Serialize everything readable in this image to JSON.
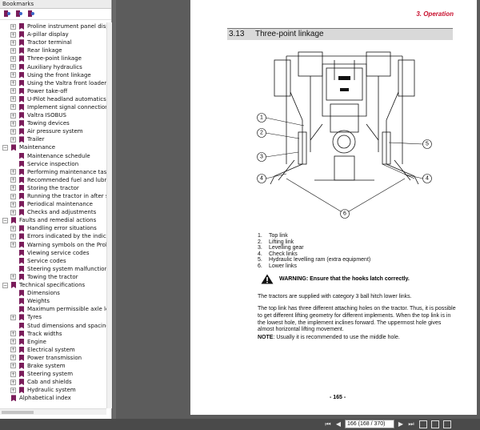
{
  "panel": {
    "title": "Bookmarks",
    "items": [
      {
        "label": "Proline instrument panel display",
        "level": 1,
        "expander": "+"
      },
      {
        "label": "A-pillar display",
        "level": 1,
        "expander": "+"
      },
      {
        "label": "Tractor terminal",
        "level": 1,
        "expander": "+"
      },
      {
        "label": "Rear linkage",
        "level": 1,
        "expander": "+"
      },
      {
        "label": "Three-point linkage",
        "level": 1,
        "expander": "+"
      },
      {
        "label": "Auxiliary hydraulics",
        "level": 1,
        "expander": "+"
      },
      {
        "label": "Using the front linkage",
        "level": 1,
        "expander": "+"
      },
      {
        "label": "Using the Valtra front loader",
        "level": 1,
        "expander": "+"
      },
      {
        "label": "Power take-off",
        "level": 1,
        "expander": "+"
      },
      {
        "label": "U-Pilot headland automatics",
        "level": 1,
        "expander": "+"
      },
      {
        "label": "Implement signal connection",
        "level": 1,
        "expander": "+"
      },
      {
        "label": "Valtra ISOBUS",
        "level": 1,
        "expander": "+"
      },
      {
        "label": "Towing devices",
        "level": 1,
        "expander": "+"
      },
      {
        "label": "Air pressure system",
        "level": 1,
        "expander": "+"
      },
      {
        "label": "Trailer",
        "level": 1,
        "expander": "+"
      },
      {
        "label": "Maintenance",
        "level": 0,
        "expander": "−"
      },
      {
        "label": "Maintenance schedule",
        "level": 1,
        "expander": ""
      },
      {
        "label": "Service inspection",
        "level": 1,
        "expander": ""
      },
      {
        "label": "Performing maintenance tasks",
        "level": 1,
        "expander": "+"
      },
      {
        "label": "Recommended fuel and lubricants",
        "level": 1,
        "expander": "+"
      },
      {
        "label": "Storing the tractor",
        "level": 1,
        "expander": "+"
      },
      {
        "label": "Running the tractor in after storage",
        "level": 1,
        "expander": "+"
      },
      {
        "label": "Periodical maintenance",
        "level": 1,
        "expander": "+"
      },
      {
        "label": "Checks and adjustments",
        "level": 1,
        "expander": "+"
      },
      {
        "label": "Faults and remedial actions",
        "level": 0,
        "expander": "−"
      },
      {
        "label": "Handling error situations",
        "level": 1,
        "expander": "+"
      },
      {
        "label": "Errors indicated by the indicator",
        "level": 1,
        "expander": "+"
      },
      {
        "label": "Warning symbols on the Proline",
        "level": 1,
        "expander": "+"
      },
      {
        "label": "Viewing service codes",
        "level": 1,
        "expander": ""
      },
      {
        "label": "Service codes",
        "level": 1,
        "expander": ""
      },
      {
        "label": "Steering system malfunctions",
        "level": 1,
        "expander": ""
      },
      {
        "label": "Towing the tractor",
        "level": 1,
        "expander": "+"
      },
      {
        "label": "Technical specifications",
        "level": 0,
        "expander": "−"
      },
      {
        "label": "Dimensions",
        "level": 1,
        "expander": ""
      },
      {
        "label": "Weights",
        "level": 1,
        "expander": ""
      },
      {
        "label": "Maximum permissible axle loadings",
        "level": 1,
        "expander": ""
      },
      {
        "label": "Tyres",
        "level": 1,
        "expander": "+"
      },
      {
        "label": "Stud dimensions and spacing for",
        "level": 1,
        "expander": ""
      },
      {
        "label": "Track widths",
        "level": 1,
        "expander": "+"
      },
      {
        "label": "Engine",
        "level": 1,
        "expander": "+"
      },
      {
        "label": "Electrical system",
        "level": 1,
        "expander": "+"
      },
      {
        "label": "Power transmission",
        "level": 1,
        "expander": "+"
      },
      {
        "label": "Brake system",
        "level": 1,
        "expander": "+"
      },
      {
        "label": "Steering system",
        "level": 1,
        "expander": "+"
      },
      {
        "label": "Cab and shields",
        "level": 1,
        "expander": "+"
      },
      {
        "label": "Hydraulic system",
        "level": 1,
        "expander": "+"
      },
      {
        "label": "Alphabetical index",
        "level": 0,
        "expander": ""
      }
    ]
  },
  "page": {
    "header": "3. Operation",
    "section_number": "3.13",
    "section_title": "Three-point linkage",
    "callouts": [
      "1",
      "2",
      "3",
      "4",
      "5",
      "4",
      "6"
    ],
    "legend": [
      {
        "n": "1.",
        "text": "Top link"
      },
      {
        "n": "2.",
        "text": "Lifting link"
      },
      {
        "n": "3.",
        "text": "Levelling gear"
      },
      {
        "n": "4.",
        "text": "Check links"
      },
      {
        "n": "5.",
        "text": "Hydraulic levelling ram (extra equipment)"
      },
      {
        "n": "6.",
        "text": "Lower links"
      }
    ],
    "warning": "WARNING: Ensure that the hooks latch correctly.",
    "para1": "The tractors are supplied with category 3 ball hitch lower links.",
    "para2": "The top link has three different attaching holes on the tractor. Thus, it is possible to get different lifting geometry for different implements. When the top link is in the lowest hole, the implement inclines forward. The uppermost hole gives almost horizontal lifting movement.",
    "note_label": "NOTE",
    "note_text": ": Usually it is recommended to use the middle hole.",
    "page_number": "- 165 -"
  },
  "toolbar": {
    "page_field": "166 (168 / 370)"
  }
}
